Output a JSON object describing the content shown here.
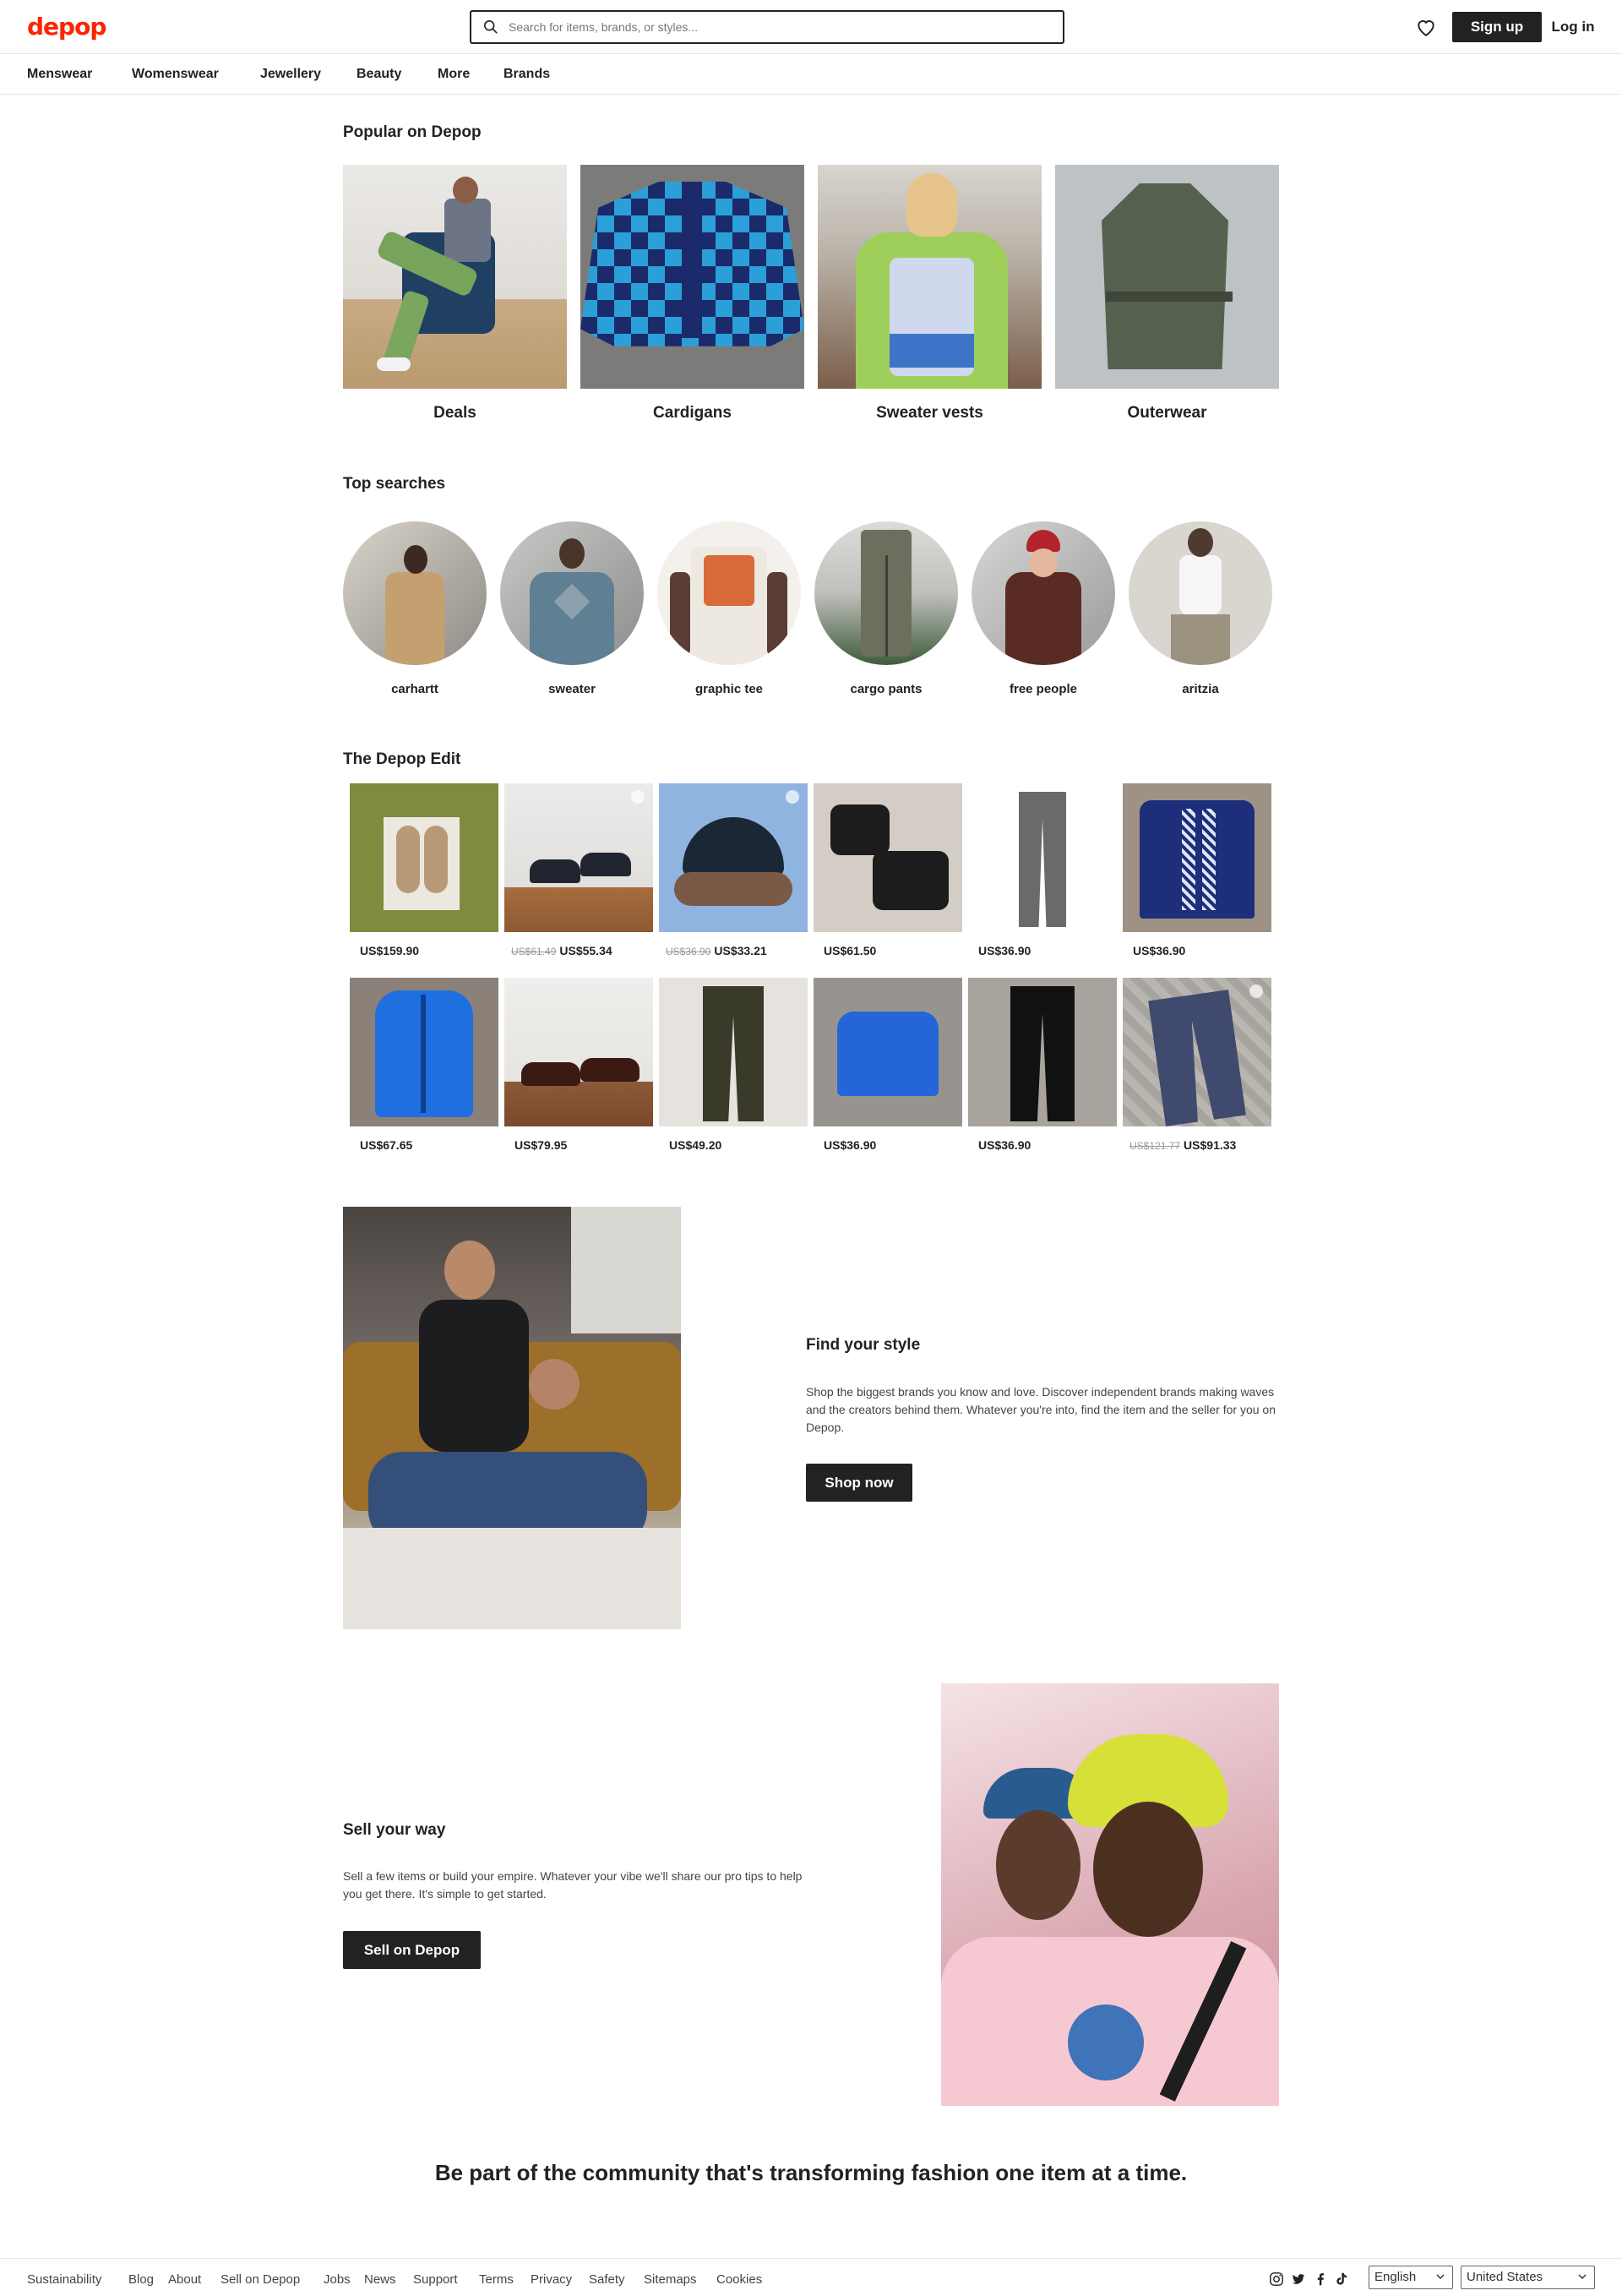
{
  "header": {
    "logo": "depop",
    "search_placeholder": "Search for items, brands, or styles...",
    "signup_label": "Sign up",
    "login_label": "Log in"
  },
  "nav": {
    "items": [
      "Menswear",
      "Womenswear",
      "Jewellery",
      "Beauty",
      "More",
      "Brands"
    ]
  },
  "popular": {
    "title": "Popular on Depop",
    "items": [
      {
        "label": "Deals"
      },
      {
        "label": "Cardigans"
      },
      {
        "label": "Sweater vests"
      },
      {
        "label": "Outerwear"
      }
    ]
  },
  "top_searches": {
    "title": "Top searches",
    "items": [
      "carhartt",
      "sweater",
      "graphic tee",
      "cargo pants",
      "free people",
      "aritzia"
    ]
  },
  "edit": {
    "title": "The Depop Edit",
    "items": [
      {
        "old": "",
        "price": "US$159.90"
      },
      {
        "old": "US$61.49",
        "price": "US$55.34"
      },
      {
        "old": "US$36.90",
        "price": "US$33.21"
      },
      {
        "old": "",
        "price": "US$61.50"
      },
      {
        "old": "",
        "price": "US$36.90"
      },
      {
        "old": "",
        "price": "US$36.90"
      },
      {
        "old": "",
        "price": "US$67.65"
      },
      {
        "old": "",
        "price": "US$79.95"
      },
      {
        "old": "",
        "price": "US$49.20"
      },
      {
        "old": "",
        "price": "US$36.90"
      },
      {
        "old": "",
        "price": "US$36.90"
      },
      {
        "old": "US$121.77",
        "price": "US$91.33"
      }
    ]
  },
  "find_style": {
    "heading": "Find your style",
    "text": "Shop the biggest brands you know and love. Discover independent brands making waves and the creators behind them. Whatever you're into, find the item and the seller for you on Depop.",
    "button": "Shop now"
  },
  "sell": {
    "heading": "Sell your way",
    "text": "Sell a few items or build your empire. Whatever your vibe we'll share our pro tips to help you get there. It's simple to get started.",
    "button": "Sell on Depop"
  },
  "community": "Be part of the community that's transforming fashion one item at a time.",
  "footer": {
    "links": [
      "Sustainability",
      "Blog",
      "About",
      "Sell on Depop",
      "Jobs",
      "News",
      "Support",
      "Terms",
      "Privacy",
      "Safety",
      "Sitemaps",
      "Cookies"
    ],
    "language": "English",
    "country": "United States"
  },
  "colors": {
    "brand": "#ff2300",
    "dark": "#222222"
  }
}
